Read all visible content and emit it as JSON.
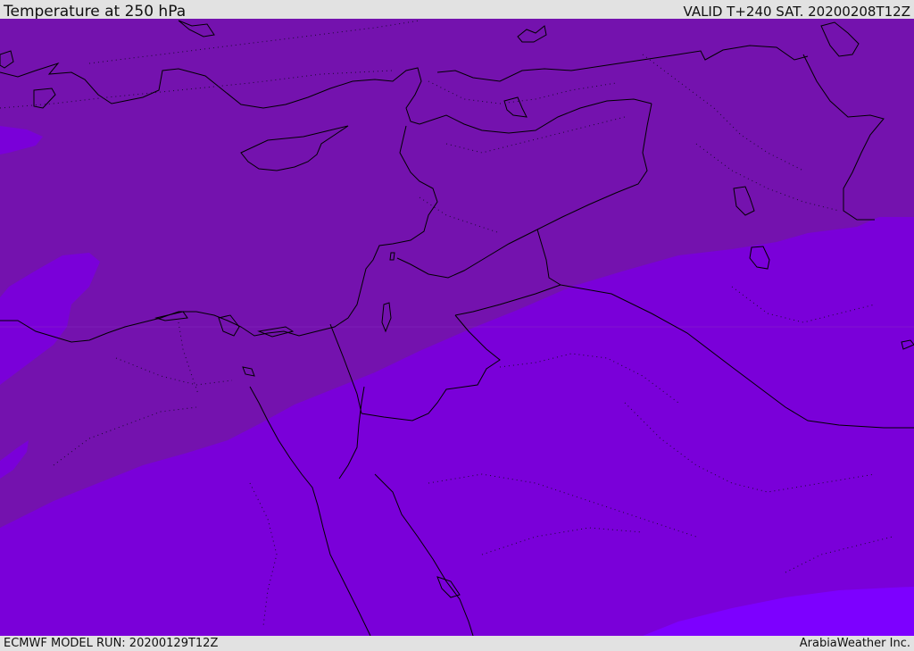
{
  "header": {
    "title": "Temperature at 250 hPa",
    "valid": "VALID T+240 SAT. 20200208T12Z"
  },
  "footer": {
    "model_run": "ECMWF MODEL RUN: 20200129T12Z",
    "credit": "ArabiaWeather Inc."
  },
  "map": {
    "field": "Temperature at 250 hPa",
    "colors": {
      "band_cold_dark": "#7412ae",
      "band_mid": "#7a00d9",
      "band_bright": "#7d00ff",
      "borders": "#000000"
    }
  }
}
